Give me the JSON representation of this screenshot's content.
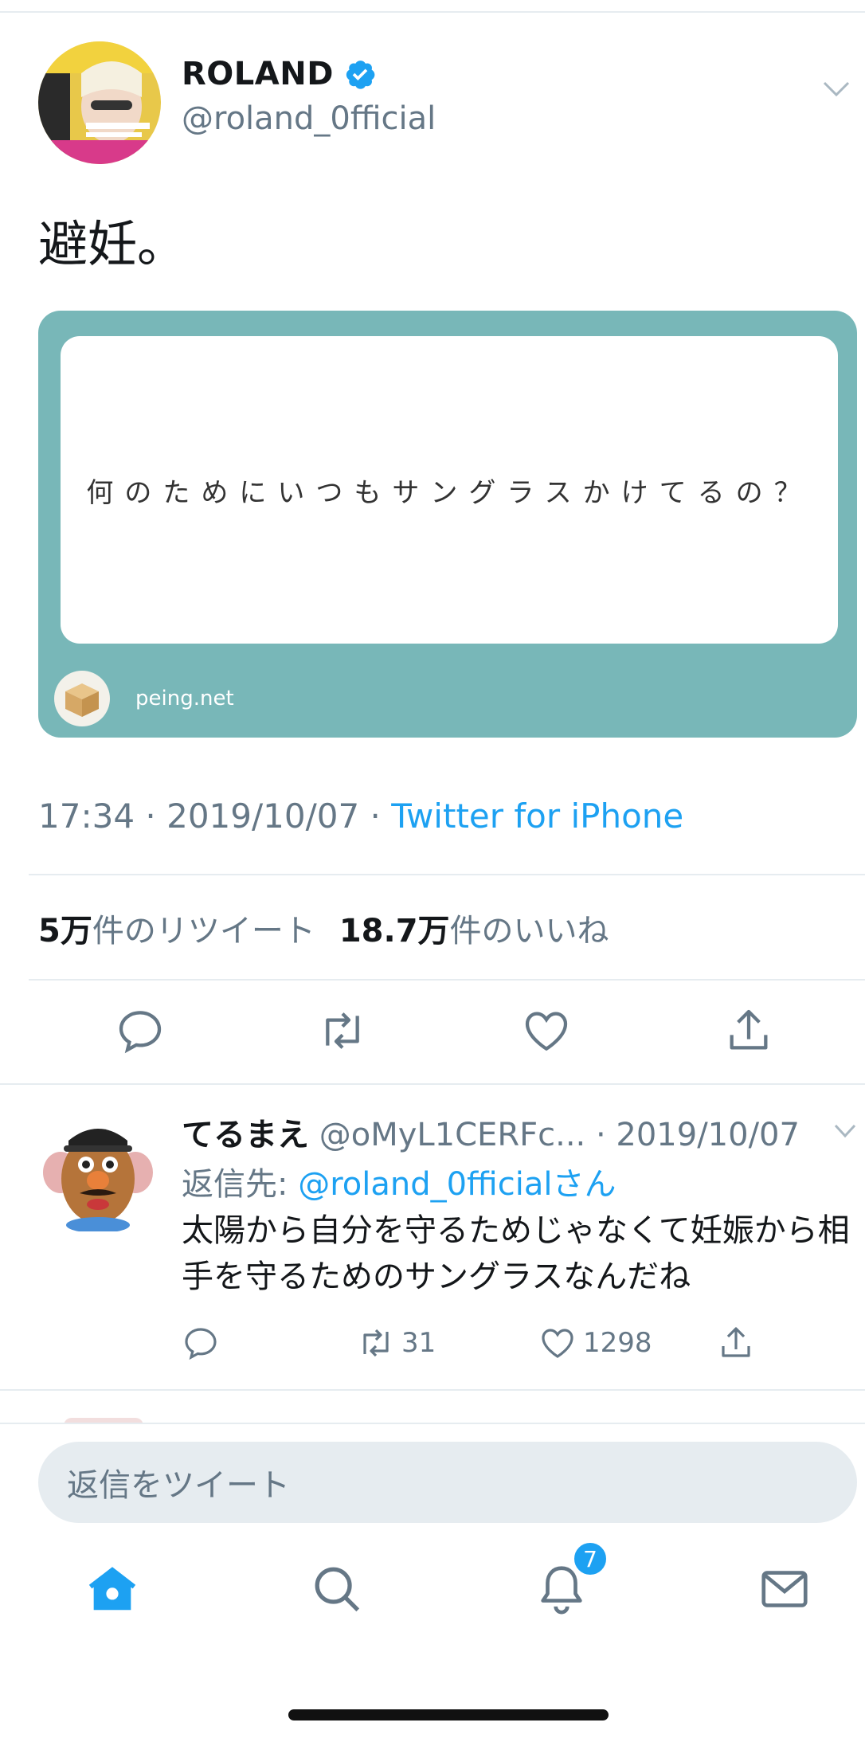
{
  "tweet": {
    "author_name": "ROLAND",
    "author_handle": "@roland_0fficial",
    "text": "避妊。",
    "card": {
      "question": "何のためにいつもサングラスかけてるの？",
      "site": "peing.net"
    },
    "meta": {
      "time": "17:34",
      "separator": " · ",
      "date": "2019/10/07",
      "client": "Twitter for iPhone"
    },
    "stats": {
      "retweets_count": "5万",
      "retweets_label": "件のリツイート",
      "likes_count": "18.7万",
      "likes_label": "件のいいね"
    }
  },
  "reply": {
    "name": "てるまえ",
    "handle": "@oMyL1CERFc...",
    "date": "· 2019/10/07",
    "reply_to_label": "返信先: ",
    "reply_to_mention": "@roland_0fficialさん",
    "text": "太陽から自分を守るためじゃなくて妊娠から相手を守るためのサングラスなんだね",
    "retweets": "31",
    "likes": "1298"
  },
  "composer": {
    "placeholder": "返信をツイート"
  },
  "tabbar": {
    "notifications_badge": "7"
  },
  "colors": {
    "accent": "#1da1f2",
    "secondary_text": "#657786",
    "card_teal": "#78b7b8"
  },
  "icons": [
    "verified-badge-icon",
    "chevron-down-icon",
    "reply-icon",
    "retweet-icon",
    "like-icon",
    "share-icon",
    "home-icon",
    "search-icon",
    "bell-icon",
    "mail-icon"
  ]
}
